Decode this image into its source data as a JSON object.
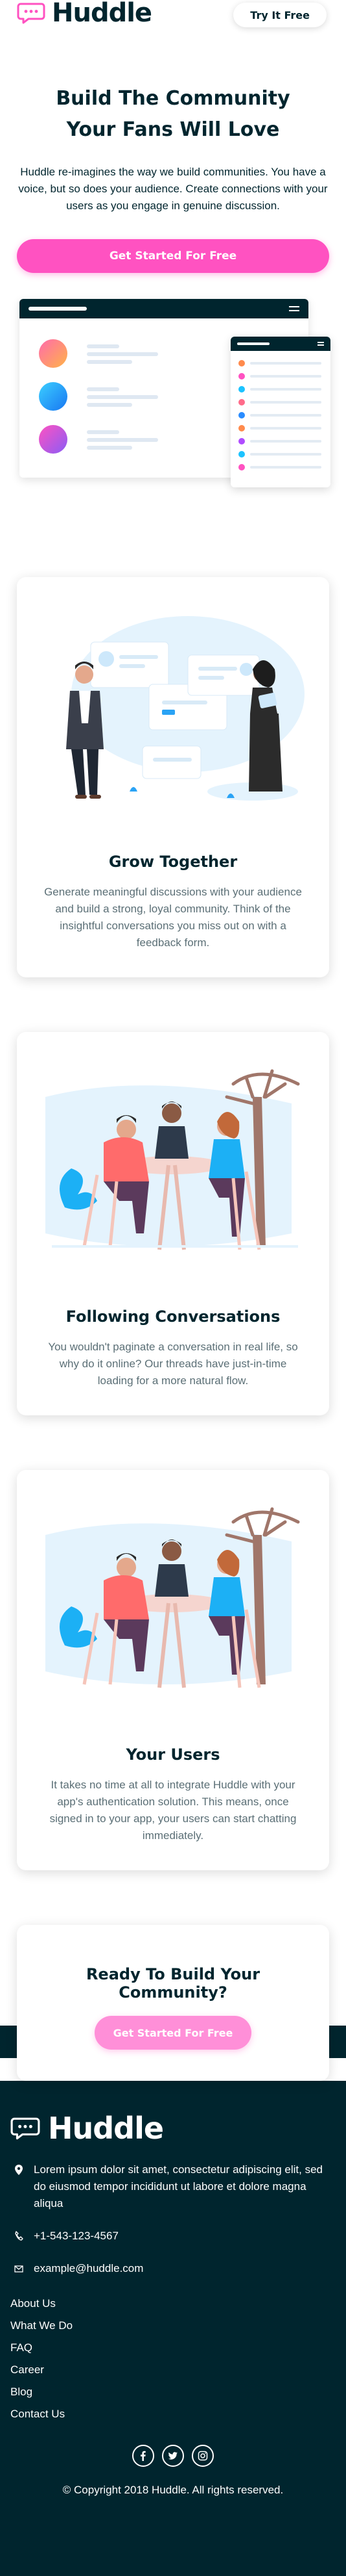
{
  "brand": {
    "name": "Huddle"
  },
  "header": {
    "try_button": "Try It Free"
  },
  "hero": {
    "title": "Build The Community Your Fans Will Love",
    "description": "Huddle re-imagines the way we build communities. You have a voice, but so does your audience. Create connections with your users as you engage in genuine discussion.",
    "cta": "Get Started For Free"
  },
  "features": [
    {
      "title": "Grow Together",
      "description": "Generate meaningful discussions with your audience and build a strong, loyal community. Think of the insightful conversations you miss out on with a feedback form."
    },
    {
      "title": "Following Conversations",
      "description": "You wouldn't paginate a conversation in real life, so why do it online? Our threads have just-in-time loading for a more natural flow."
    },
    {
      "title": "Your Users",
      "description": "It takes no time at all to integrate Huddle with your app's authentication solution. This means, once signed in to your app, your users can start chatting immediately."
    }
  ],
  "cta_section": {
    "title": "Ready To Build Your Community?",
    "button": "Get Started For Free"
  },
  "footer": {
    "address": "Lorem ipsum dolor sit amet, consectetur adipiscing elit, sed do eiusmod tempor incididunt ut labore et dolore magna aliqua",
    "phone": "+1-543-123-4567",
    "email": "example@huddle.com",
    "links": [
      "About Us",
      "What We Do",
      "FAQ",
      "Career",
      "Blog",
      "Contact Us"
    ],
    "socials": [
      "facebook-icon",
      "twitter-icon",
      "instagram-icon"
    ],
    "copyright": "© Copyright 2018 Huddle. All rights reserved."
  },
  "colors": {
    "dark": "#00252e",
    "pink": "#ff52c1",
    "pink_light": "#ff8fd8",
    "text_muted": "#5b6f76"
  }
}
